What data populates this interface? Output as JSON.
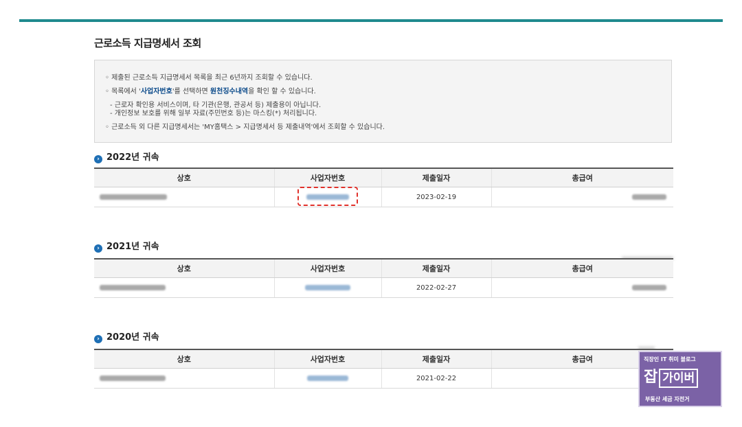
{
  "page": {
    "title": "근로소득 지급명세서 조회"
  },
  "notice": {
    "line1": "◦ 제출된 근로소득 지급명세서 목록을 최근 6년까지 조회할 수 있습니다.",
    "line2_prefix": "◦ 목록에서 '",
    "line2_hl1": "사업자번호",
    "line2_mid": "'를 선택하면 ",
    "line2_hl2": "원천징수내역",
    "line2_suffix": "을 확인 할 수 있습니다.",
    "line3": "- 근로자 확인용 서비스이며, 타 기관(은행, 관공서 등) 제출용이 아닙니다.",
    "line4": "- 개인정보 보호를 위해 일부 자료(주민번호 등)는 마스킹(*) 처리됩니다.",
    "line5": "◦ 근로소득 외 다른 지급명세서는 'MY홈택스 > 지급명세서 등 제출내역'에서 조회할 수 있습니다."
  },
  "columns": {
    "company": "상호",
    "bizno": "사업자번호",
    "date": "제출일자",
    "salary": "총급여"
  },
  "sections": [
    {
      "title": "2022년 귀속",
      "date": "2023-02-19"
    },
    {
      "title": "2021년 귀속",
      "date": "2022-02-27"
    },
    {
      "title": "2020년 귀속",
      "date": "2021-02-22"
    }
  ],
  "icons": {
    "bullet": "arrow-circle-icon"
  },
  "colors": {
    "accent": "#1f8a8e",
    "link": "#0b4a8a",
    "highlight_border": "#e0302a",
    "logo_bg": "#7b62a6"
  },
  "watermark": {
    "top": "직장인 IT 취미 블로그",
    "main1": "잡",
    "main2": "가이버",
    "bottom": "부동산 세금 자전거"
  }
}
